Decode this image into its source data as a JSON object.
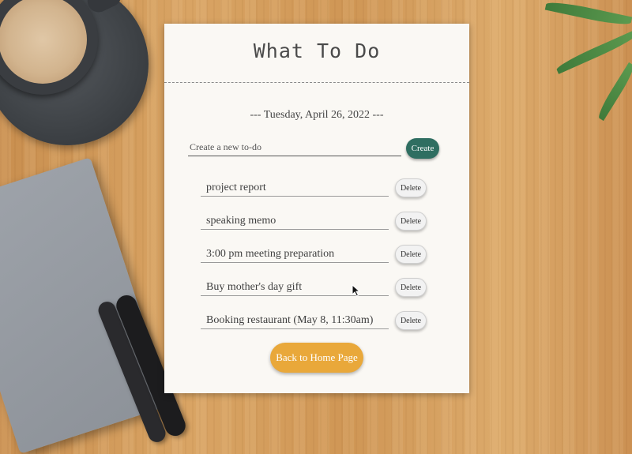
{
  "app": {
    "title": "What To Do",
    "date_line": "--- Tuesday, April 26, 2022 ---"
  },
  "new_todo": {
    "placeholder": "Create a new to-do",
    "value": "",
    "create_label": "Create"
  },
  "todos": [
    {
      "text": "project report",
      "delete_label": "Delete"
    },
    {
      "text": "speaking memo",
      "delete_label": "Delete"
    },
    {
      "text": "3:00 pm meeting preparation",
      "delete_label": "Delete"
    },
    {
      "text": "Buy mother's day gift",
      "delete_label": "Delete"
    },
    {
      "text": "Booking restaurant (May 8, 11:30am)",
      "delete_label": "Delete"
    }
  ],
  "footer": {
    "home_label": "Back to Home Page"
  },
  "colors": {
    "create_button": "#2f6e61",
    "home_button": "#e9a83a",
    "paper": "#faf8f4"
  },
  "icons": {
    "pointer": "mouse-pointer-icon"
  }
}
